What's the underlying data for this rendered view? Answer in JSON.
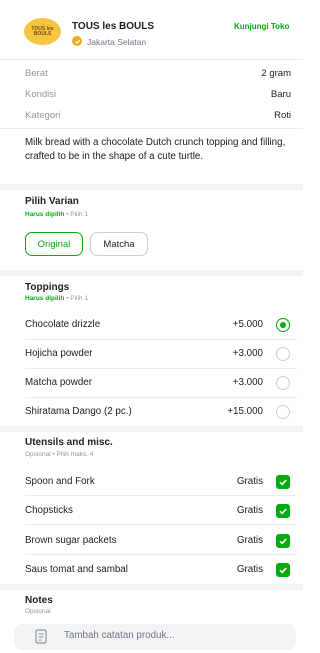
{
  "store": {
    "logo_text": "TOUS les BOULS",
    "name": "TOUS les BOULS",
    "location": "Jakarta Selatan",
    "visit_label": "Kunjungi Toko"
  },
  "attributes": [
    {
      "label": "Berat",
      "value": "2 gram"
    },
    {
      "label": "Kondisi",
      "value": "Baru"
    },
    {
      "label": "Kategori",
      "value": "Roti"
    }
  ],
  "description": "Milk bread with a chocolate Dutch crunch topping and filling, crafted to be in the shape of a cute turtle.",
  "variant": {
    "title": "Pilih Varian",
    "required": "Harus dipilih",
    "hint": "Pilih 1",
    "options": [
      "Original",
      "Matcha"
    ],
    "selected": "Original"
  },
  "toppings": {
    "title": "Toppings",
    "required": "Harus dipilih",
    "hint": "Pilih 1",
    "items": [
      {
        "label": "Chocolate drizzle",
        "price": "+5.000",
        "selected": true
      },
      {
        "label": "Hojicha powder",
        "price": "+3.000",
        "selected": false
      },
      {
        "label": "Matcha powder",
        "price": "+3.000",
        "selected": false
      },
      {
        "label": "Shiratama Dango (2 pc.)",
        "price": "+15.000",
        "selected": false
      }
    ]
  },
  "utensils": {
    "title": "Utensils and misc.",
    "optional": "Opsional",
    "hint": "Pilih maks. 4",
    "items": [
      {
        "label": "Spoon and Fork",
        "price": "Gratis",
        "checked": true
      },
      {
        "label": "Chopsticks",
        "price": "Gratis",
        "checked": true
      },
      {
        "label": "Brown sugar packets",
        "price": "Gratis",
        "checked": true
      },
      {
        "label": "Saus tomat and sambal",
        "price": "Gratis",
        "checked": true
      }
    ]
  },
  "notes": {
    "title": "Notes",
    "optional": "Opsional",
    "placeholder": "Tambah catatan produk..."
  },
  "colors": {
    "accent": "#03ac0e",
    "badge": "#f5a623",
    "logo": "#f5c542"
  }
}
